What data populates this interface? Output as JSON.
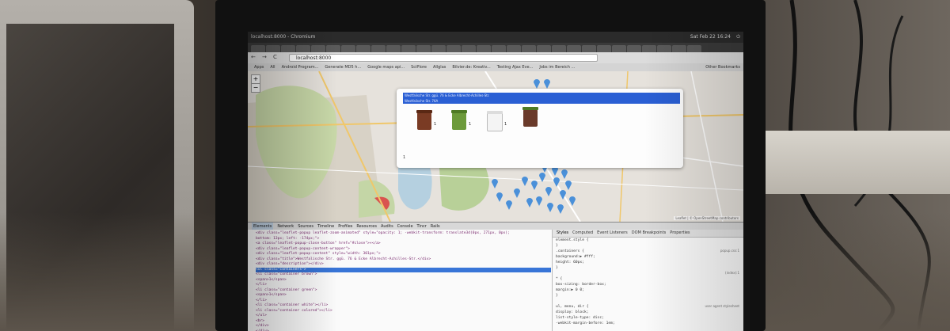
{
  "window": {
    "title": "localhost:8000 - Chromium",
    "clock": "Sat Feb 22 16:24",
    "power_icon": "power-icon"
  },
  "browser": {
    "tabs": [
      "",
      "",
      "",
      "",
      "",
      "",
      "",
      "",
      "",
      "",
      "",
      "",
      "",
      "",
      "",
      "",
      "",
      "",
      "",
      "",
      "",
      "",
      "",
      "",
      "",
      "",
      "",
      "",
      "",
      ""
    ],
    "nav": {
      "back": "←",
      "forward": "→",
      "reload": "C"
    },
    "url": "localhost:8000",
    "bookmarks": [
      "Apps",
      "All",
      "Android Program...",
      "Generate MD5 h...",
      "Google maps api...",
      "SciPlore",
      "Allglas",
      "Bilvier.de: Kreativ...",
      "Testing Ajax Eve...",
      "Jobs im Bereich ..."
    ],
    "other_bookmarks": "Other Bookmarks"
  },
  "map": {
    "zoom_in": "+",
    "zoom_out": "−",
    "popup": {
      "header_lines": [
        "Westfalische Str. ggü. 76 & Ecke Albrecht-Achilles-Str.",
        "Westfalische Str. 76A"
      ],
      "bins": [
        {
          "color": "brown",
          "count": "1"
        },
        {
          "color": "green",
          "count": "1"
        },
        {
          "color": "white",
          "count": "1"
        },
        {
          "color": "brown-green",
          "count": ""
        }
      ],
      "note": "1"
    },
    "attribution": "Leaflet | © OpenStreetMap contributors",
    "colors": {
      "popup_header": "#2a5fd4",
      "marker": "#4a90d9",
      "park": "#c8d8a8",
      "water": "#b5d0e0"
    }
  },
  "devtools": {
    "tabs": [
      "Elements",
      "Network",
      "Sources",
      "Timeline",
      "Profiles",
      "Resources",
      "Audits",
      "Console",
      "Tincr",
      "Rails"
    ],
    "active_tab": "Elements",
    "elements_code": [
      "<div class=\"leaflet-popup leaflet-zoom-animated\" style=\"opacity: 1; -webkit-transform: translate3d(0px, 271px, 0px);",
      "bottom: 13px; left: -174px;\">",
      "  <a class=\"leaflet-popup-close-button\" href=\"#close\">×</a>",
      "  <div class=\"leaflet-popup-content-wrapper\">",
      "    <div class=\"leaflet-popup-content\" style=\"width: 301px;\">",
      "      <div class=\"title\">Westfalische Str. ggü. 76 & Ecke Albrecht-Achilles-Str.</div>",
      "      <div class=\"description\"></div>",
      "      <ul class=\"containers\">",
      "        <li class=\"container brown\">",
      "          <span>1</span>",
      "        </li>",
      "        <li class=\"container green\">",
      "          <span>1</span>",
      "        </li>",
      "        <li class=\"container white\"></li>",
      "        <li class=\"container colored\"></li>",
      "      </ul>",
      "      <br>",
      "    </div>",
      "  </div>"
    ],
    "selected_line": 7,
    "styles_tabs": [
      "Styles",
      "Computed",
      "Event Listeners",
      "DOM Breakpoints",
      "Properties"
    ],
    "styles_lines": [
      "element.style {",
      "}",
      ".containers {",
      "  background:▶ #fff;",
      "  height: 60px;",
      "}",
      "",
      "* {",
      "  box-sizing: border-box;",
      "  margin:▶ 0 0;",
      "}",
      "",
      "ul, menu, dir {",
      "  display: block;",
      "  list-style-type: disc;",
      "  -webkit-margin-before: 1em;"
    ],
    "styles_notes": [
      "popup.css:1",
      "(index):1",
      "user agent stylesheet"
    ]
  }
}
